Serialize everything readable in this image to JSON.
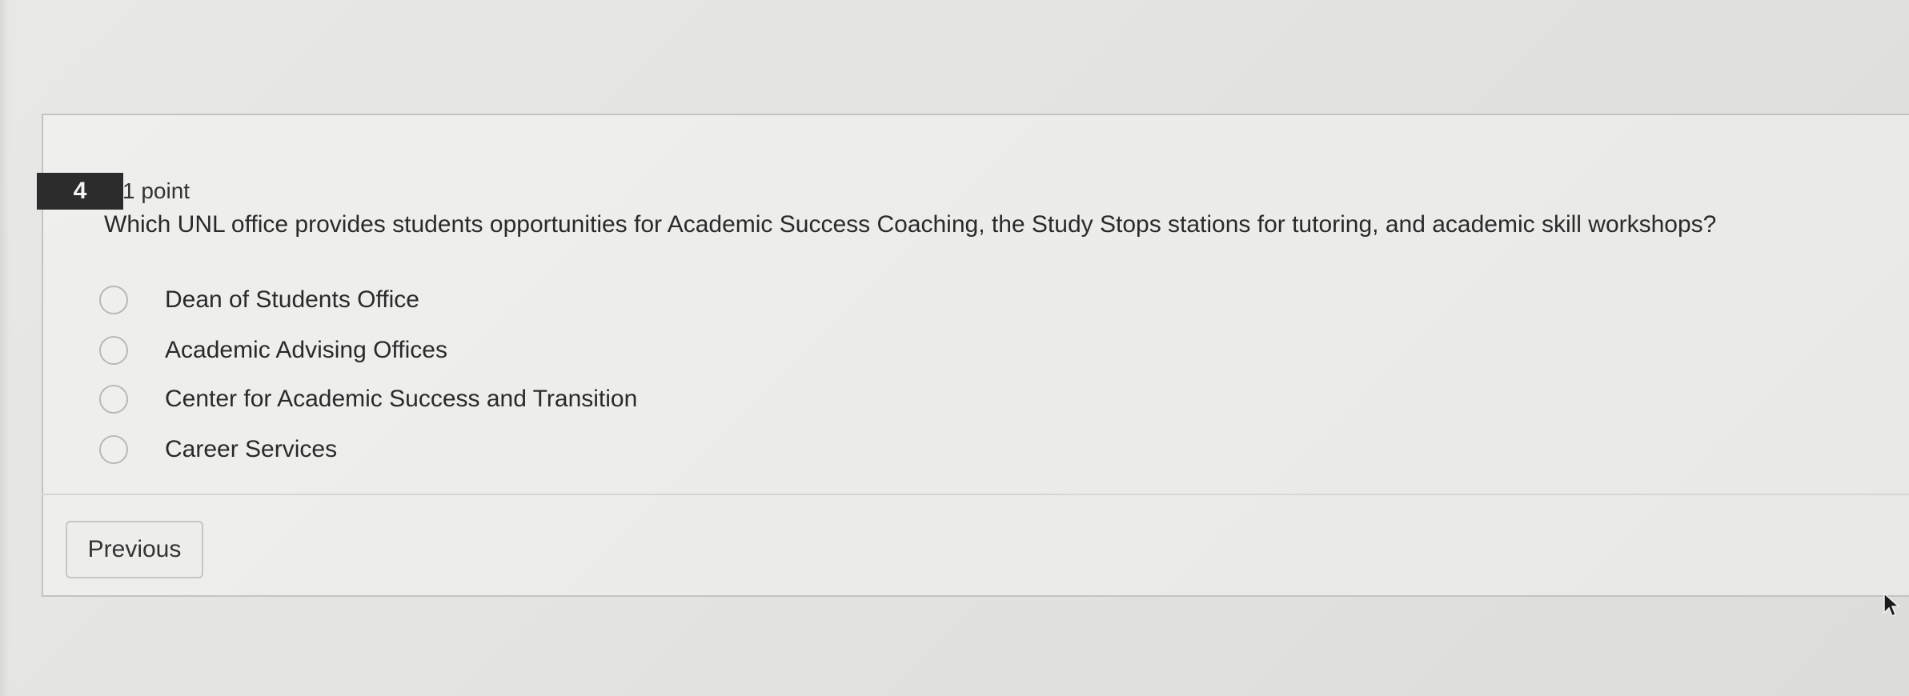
{
  "question": {
    "number": "4",
    "points": "1 point",
    "text": "Which UNL office provides students opportunities for Academic Success Coaching, the Study Stops stations for tutoring, and academic skill workshops?"
  },
  "options": [
    {
      "label": "Dean of Students Office",
      "selected": false
    },
    {
      "label": "Academic Advising Offices",
      "selected": false
    },
    {
      "label": "Center for Academic Success and Transition",
      "selected": false
    },
    {
      "label": "Career Services",
      "selected": false
    }
  ],
  "navigation": {
    "previous_label": "Previous"
  },
  "icons": {
    "cursor": "mouse-cursor-icon",
    "radio": "radio-button-icon"
  },
  "colors": {
    "badge_background": "#2c2c2c",
    "badge_text": "#f4f4f4",
    "page_background": "#e6e6e4",
    "text": "#2a2a2a"
  }
}
